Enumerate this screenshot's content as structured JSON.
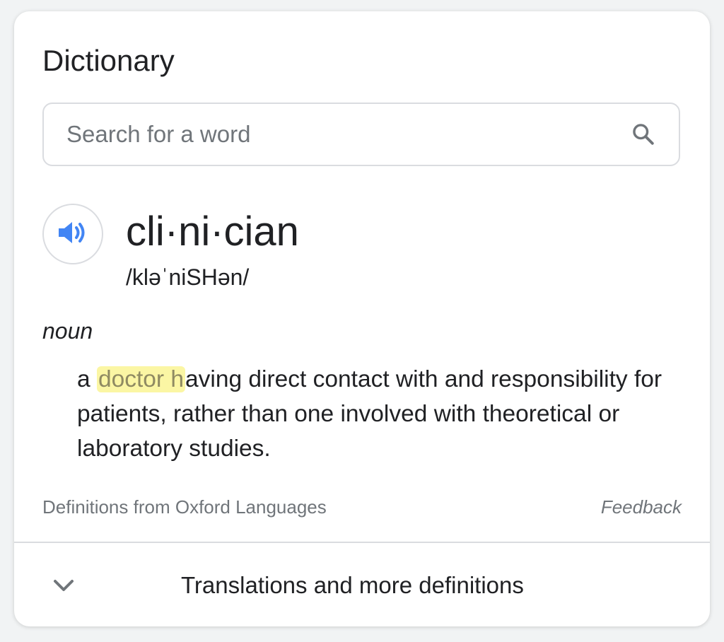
{
  "card": {
    "title": "Dictionary"
  },
  "search": {
    "placeholder": "Search for a word",
    "value": "",
    "icon": "search-icon"
  },
  "entry": {
    "audio_icon": "speaker-icon",
    "word": "cli·ni·cian",
    "phonetic": "/kləˈniSHən/",
    "part_of_speech": "noun",
    "definition": {
      "before": "a ",
      "highlight": "doctor h",
      "after": "aving direct contact with and responsibility for patients, rather than one involved with theoretical or laboratory studies."
    }
  },
  "footer": {
    "source": "Definitions from Oxford Languages",
    "feedback": "Feedback"
  },
  "more": {
    "icon": "chevron-down-icon",
    "label": "Translations and more definitions"
  },
  "colors": {
    "text": "#202124",
    "muted": "#70757a",
    "border": "#dadce0",
    "accent_blue": "#4285f4",
    "highlight": "#fbf6a4"
  }
}
